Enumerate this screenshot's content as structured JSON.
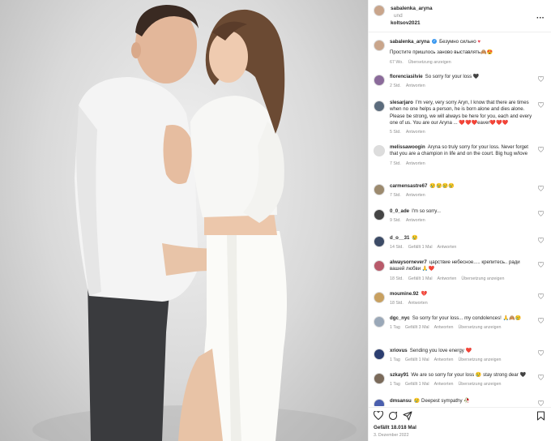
{
  "post": {
    "author": "sabalenka_aryna",
    "and_label": "und",
    "coauthor": "koltsov2021",
    "more_icon": "more-icon",
    "photo_alt": "Photo of a couple embracing in a studio"
  },
  "caption": {
    "username": "sabalenka_aryna",
    "text": "Безумно сильно",
    "text2": "Простите пришлось заново выставлять🙈😍",
    "time": "67 Wo.",
    "translate": "Übersetzung anzeigen"
  },
  "comments": [
    {
      "username": "florenciasilvie",
      "text": "So sorry for your loss 🖤",
      "time": "2 Std.",
      "likes": "",
      "reply": "Antworten",
      "translate": "",
      "avatar_color": "#8a6a9a"
    },
    {
      "username": "slesarjaro",
      "text": "I'm very, very sorry Aryn, I know that there are times when no one helps a person, he is born alone and dies alone. Please be strong, we will always be here for you, each and every one of us. You are our Aryna ... ❤️❤️❤️eaver❤️❤️❤️",
      "time": "5 Std.",
      "likes": "",
      "reply": "Antworten",
      "translate": "",
      "avatar_color": "#5b6b7c"
    },
    {
      "username": "melissawoogin",
      "text": "Aryna so truly sorry for your loss. Never forget that you are a champion in life and on the court. Big hug w/love",
      "time": "7 Std.",
      "likes": "",
      "reply": "Antworten",
      "translate": "",
      "avatar_color": "#dddddd"
    },
    {
      "username": "carmensastre67",
      "text": "😢😢😢😢",
      "time": "7 Std.",
      "likes": "",
      "reply": "Antworten",
      "translate": "",
      "avatar_color": "#9c8a6e"
    },
    {
      "username": "0_0_ade",
      "text": "I'm so sorry...",
      "time": "9 Std.",
      "likes": "",
      "reply": "Antworten",
      "translate": "",
      "avatar_color": "#444444"
    },
    {
      "username": "d_o__31",
      "text": "😢",
      "time": "14 Std.",
      "likes": "Gefällt 1 Mal",
      "reply": "Antworten",
      "translate": "",
      "avatar_color": "#3c4b66"
    },
    {
      "username": "alwaysornever7",
      "text": "царствие небесное..... крепитесь.. ради вашей любви 🙏❤️",
      "time": "18 Std.",
      "likes": "Gefällt 1 Mal",
      "reply": "Antworten",
      "translate": "Übersetzung anzeigen",
      "avatar_color": "#b85a6a"
    },
    {
      "username": "moumine.92",
      "text": "💔",
      "time": "18 Std.",
      "likes": "",
      "reply": "Antworten",
      "translate": "",
      "avatar_color": "#c8a060"
    },
    {
      "username": "dgc_nyc",
      "text": "So sorry for your loss... my condolences! 🙏🙈😢",
      "time": "1 Tag",
      "likes": "Gefällt 3 Mal",
      "reply": "Antworten",
      "translate": "Übersetzung anzeigen",
      "avatar_color": "#9aa8b8"
    },
    {
      "username": "xriovus",
      "text": "Sending you love energy ❤️",
      "time": "1 Tag",
      "likes": "Gefällt 1 Mal",
      "reply": "Antworten",
      "translate": "Übersetzung anzeigen",
      "avatar_color": "#2c3e70"
    },
    {
      "username": "szkay91",
      "text": "We are so sorry for your loss 😢 stay strong dear 🖤",
      "time": "1 Tag",
      "likes": "Gefällt 1 Mal",
      "reply": "Antworten",
      "translate": "Übersetzung anzeigen",
      "avatar_color": "#7a6a5a"
    },
    {
      "username": "dmsansu",
      "text": "😢 Deepest sympathy 🥀",
      "time": "1 Tag",
      "likes": "Gefällt 1 Mal",
      "reply": "Antworten",
      "translate": "Übersetzung anzeigen",
      "avatar_color": "#4a5fae"
    }
  ],
  "actions": {
    "like_icon": "heart-icon",
    "comment_icon": "comment-icon",
    "share_icon": "send-icon",
    "save_icon": "bookmark-icon",
    "likes_text": "Gefällt 18.018 Mal",
    "date_text": "3. Dezember 2022"
  },
  "colors": {
    "border": "#efefef",
    "muted": "#8e8e8e",
    "text": "#262626",
    "verified": "#3897f0"
  }
}
